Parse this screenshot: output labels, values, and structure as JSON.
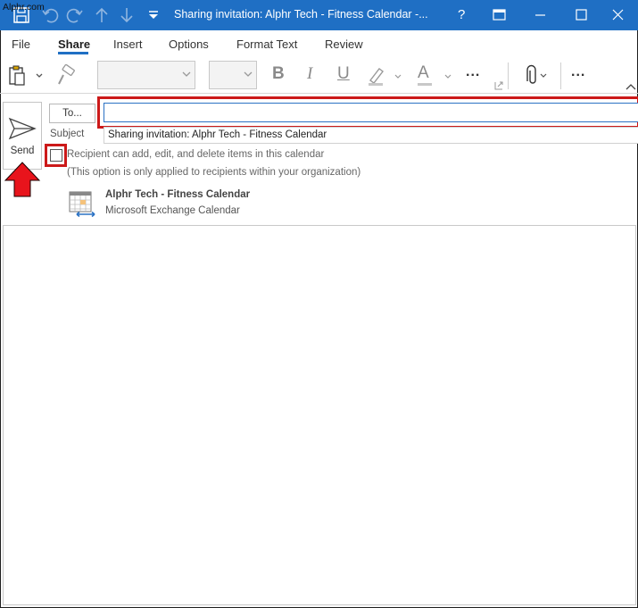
{
  "watermark": "Alphr.com",
  "window": {
    "title": "Sharing invitation: Alphr Tech - Fitness Calendar -...",
    "help_label": "?"
  },
  "tabs": [
    {
      "label": "File"
    },
    {
      "label": "Share",
      "active": true
    },
    {
      "label": "Insert"
    },
    {
      "label": "Options"
    },
    {
      "label": "Format Text"
    },
    {
      "label": "Review"
    }
  ],
  "ribbon": {
    "bold": "B",
    "italic": "I",
    "underline": "U",
    "font_color": "A",
    "more": "...",
    "more2": "..."
  },
  "compose": {
    "send_label": "Send",
    "to_label": "To...",
    "to_value": "",
    "subject_label": "Subject",
    "subject_value": "Sharing invitation: Alphr Tech - Fitness Calendar",
    "permission_label": "Recipient can add, edit, and delete items in this calendar",
    "permission_checked": false,
    "permission_note": "(This option is only applied to recipients within your organization)",
    "calendar_name": "Alphr Tech - Fitness Calendar",
    "calendar_type": "Microsoft Exchange Calendar"
  },
  "colors": {
    "titlebar": "#1f6fc4",
    "highlight": "#cc1919"
  },
  "icons": [
    "save-icon",
    "undo-icon",
    "redo-icon",
    "up-icon",
    "down-icon",
    "customize-icon",
    "help-icon",
    "restore-icon",
    "minimize-icon",
    "maximize-icon",
    "close-icon",
    "paste-icon",
    "format-painter-icon",
    "highlighter-icon",
    "attach-icon",
    "send-icon",
    "calendar-icon",
    "arrow-icon"
  ]
}
